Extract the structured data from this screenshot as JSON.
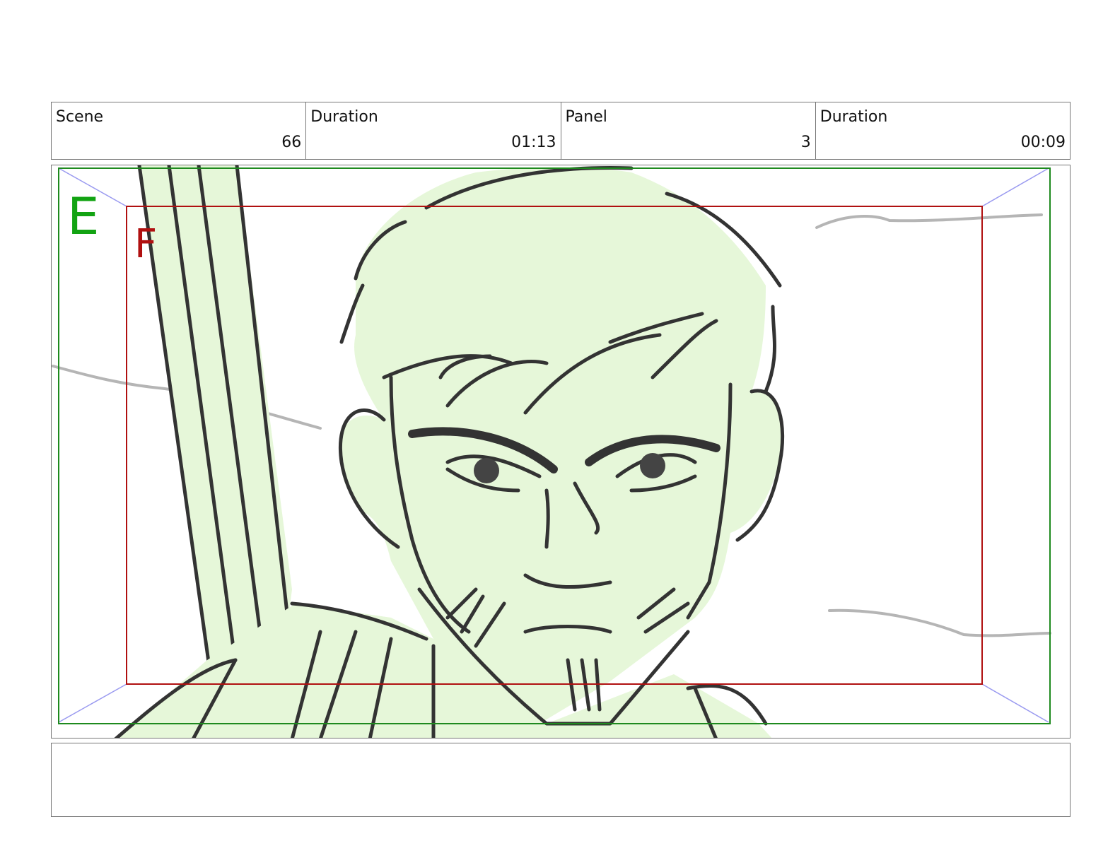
{
  "header": {
    "scene": {
      "label": "Scene",
      "value": "66"
    },
    "scene_duration": {
      "label": "Duration",
      "value": "01:13"
    },
    "panel": {
      "label": "Panel",
      "value": "3"
    },
    "panel_duration": {
      "label": "Duration",
      "value": "00:09"
    }
  },
  "frame": {
    "outer_field_label": "E",
    "inner_field_label": "F",
    "colors": {
      "outer_field": "#1e8a1e",
      "inner_field": "#b01010",
      "fill": "#e6f7d9",
      "line": "#333333",
      "guide": "#9a9af0"
    },
    "drawing": "character-close-up-sketch"
  },
  "notes": {
    "text": ""
  }
}
